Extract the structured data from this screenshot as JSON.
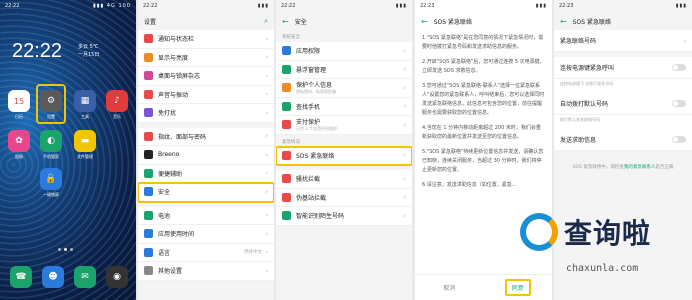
{
  "home": {
    "status_time": "22:22",
    "status_right": "▮▮▮ 4G 100",
    "clock": "22:22",
    "date_line1": "多云 5℃",
    "date_line2": "一月15日",
    "apps_row1": [
      {
        "label": "日历",
        "glyph": "15",
        "color": "#ffffff"
      },
      {
        "label": "设置",
        "glyph": "⚙",
        "color": "#5a5a5a"
      },
      {
        "label": "工具",
        "glyph": "▦",
        "color": "#3a5fa8"
      },
      {
        "label": "音乐",
        "glyph": "♪",
        "color": "#e23b3b"
      }
    ],
    "apps_row2": [
      {
        "label": "相册",
        "glyph": "✿",
        "color": "#e8478b"
      },
      {
        "label": "手机管家",
        "glyph": "◐",
        "color": "#1aa36a"
      },
      {
        "label": "文件管理",
        "glyph": "▬",
        "color": "#f3c400"
      }
    ],
    "app_row3": {
      "label": "一键锁屏",
      "glyph": "🔒",
      "color": "#2a7bdc"
    },
    "dock": [
      {
        "glyph": "☎",
        "color": "#1aa36a"
      },
      {
        "glyph": "☻",
        "color": "#2a7bdc"
      },
      {
        "glyph": "✉",
        "color": "#1aa36a"
      },
      {
        "glyph": "◉",
        "color": "#333333"
      }
    ]
  },
  "settings": {
    "status_time": "22:22",
    "title": "设置",
    "items": [
      {
        "label": "通知与状态栏",
        "color": "#e84a4a"
      },
      {
        "label": "显示与亮度",
        "color": "#f08a24"
      },
      {
        "label": "桌面与锁屏杂志",
        "color": "#d14a9a"
      },
      {
        "label": "声音与振动",
        "color": "#e84a4a"
      },
      {
        "label": "免打扰",
        "color": "#7a55d6"
      },
      {
        "label": "指纹、面部与密码",
        "color": "#e84a4a"
      },
      {
        "label": "Breeno",
        "color": "#222222"
      },
      {
        "label": "便捷辅助",
        "color": "#1aa36a"
      },
      {
        "label": "安全",
        "color": "#2a7bdc"
      },
      {
        "label": "电池",
        "color": "#1aa36a"
      },
      {
        "label": "应用使用时间",
        "color": "#2a7bdc"
      },
      {
        "label": "语言",
        "color": "#2a7bdc",
        "value": "简体中文"
      },
      {
        "label": "其他设置",
        "color": "#888888"
      }
    ]
  },
  "security": {
    "status_time": "22:22",
    "title": "安全",
    "section1": "系统安全",
    "items1": [
      {
        "label": "应用权限",
        "color": "#2a7bdc"
      },
      {
        "label": "悬浮窗管理",
        "color": "#1aa36a"
      },
      {
        "label": "保护个人信息",
        "color": "#f08a24",
        "sub": "隐私密码、私密保险箱"
      },
      {
        "label": "查找手机",
        "color": "#1aa36a"
      },
      {
        "label": "支付保护",
        "color": "#e84a4a",
        "sub": "已对 2 个应用开启保护"
      }
    ],
    "section2": "紧急情况",
    "sos": {
      "label": "SOS 紧急联络",
      "color": "#e84a4a"
    },
    "items2": [
      {
        "label": "骚扰拦截",
        "color": "#e84a4a"
      },
      {
        "label": "伪基站拦截",
        "color": "#e84a4a"
      },
      {
        "label": "智能识别陌生号码",
        "color": "#1aa36a"
      }
    ]
  },
  "sos_terms": {
    "status_time": "22:23",
    "title": "SOS 紧急联络",
    "paragraphs": [
      "1.\"SOS 紧急联络\"是在您同意的情况下紧急情况时，需要时他拨打紧急号码和发送求助信息的服务。",
      "2.开启\"SOS 紧急联络\"后，您可通过连按 5 次电源键，立即发送 SOS 求救信息。",
      "3.您可通过\"SOS 紧急联络-联系人\"选择一位紧急联系人\"设置您的紧急联系人，呼叫结束后，您可以选择同时发送紧急联络信息，此信息可包含您的位置，前往提醒服务也需要获取您的位置信息。",
      "4.当您在 1 分钟内移动距离超过 200 米时，我们会重新获取您的最新位置并发送至您的位置信息。",
      "5.\"SOS 紧急联络\"持续更新位置信息并发送，请确认您已知晓，连续关闭服务，当超过 30 分钟时，我们将停止更新您的位置。",
      "6.请注意，发送求助信息（如位置、紧急..."
    ],
    "cancel_label": "取消",
    "agree_label": "同意"
  },
  "sos_settings": {
    "status_time": "22:23",
    "title": "SOS 紧急联络",
    "rows": [
      {
        "label": "紧急联络号码",
        "type": "chev"
      },
      {
        "label": "连按电源键紧急呼叫",
        "type": "toggle",
        "hint": "连按电源键 5 次拨打紧急号码"
      },
      {
        "label": "自动拨打默认号码",
        "type": "toggle",
        "hint": "拨打默认紧急联络号码"
      },
      {
        "label": "发送求助信息",
        "type": "toggle"
      }
    ],
    "foot_prefix": "SOS 紧急联络中，请检查",
    "foot_link": "我的紧急联系人",
    "foot_suffix": "是否正确"
  },
  "watermark": {
    "brand": "查询啦",
    "url": "chaxunla.com"
  }
}
